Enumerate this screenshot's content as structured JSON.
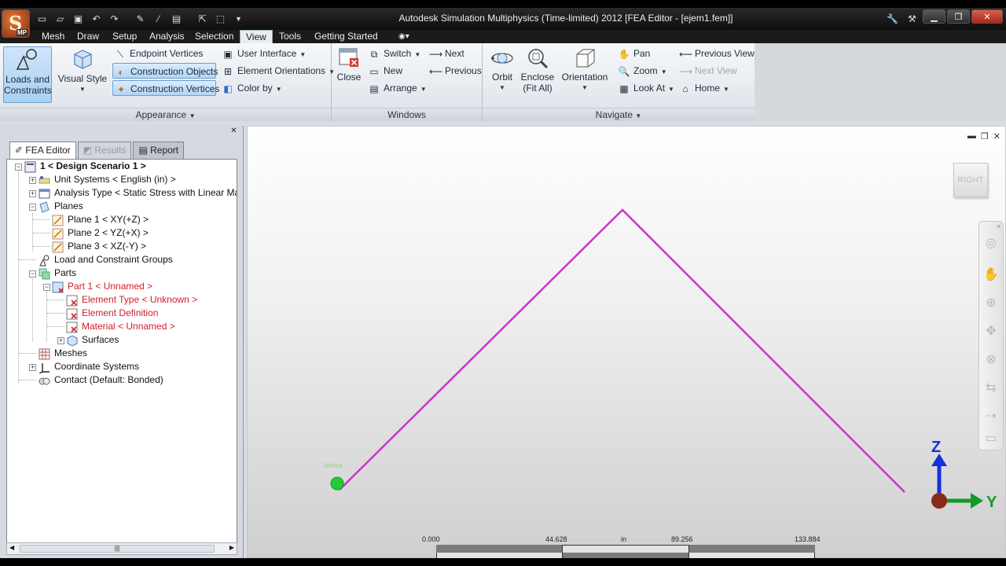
{
  "window": {
    "title": "Autodesk Simulation Multiphysics (Time-limited) 2012     [FEA Editor - [ejem1.fem]]"
  },
  "app_button": {
    "letter": "S",
    "badge": "MP"
  },
  "menu": {
    "tabs": [
      "Mesh",
      "Draw",
      "Setup",
      "Analysis",
      "Selection",
      "View",
      "Tools",
      "Getting Started"
    ],
    "active": "View"
  },
  "ribbon": {
    "appearance": {
      "label": "Appearance",
      "loads_and_constraints": "Loads and Constraints",
      "visual_style": "Visual Style",
      "endpoint_vertices": "Endpoint Vertices",
      "construction_objects": "Construction Objects",
      "construction_vertices": "Construction Vertices",
      "user_interface": "User Interface",
      "element_orientations": "Element Orientations",
      "color_by": "Color by"
    },
    "windows": {
      "label": "Windows",
      "close": "Close",
      "switch": "Switch",
      "new": "New",
      "arrange": "Arrange",
      "next": "Next",
      "previous": "Previous"
    },
    "navigate": {
      "label": "Navigate",
      "orbit": "Orbit",
      "enclose": "Enclose (Fit All)",
      "orientation": "Orientation",
      "pan": "Pan",
      "zoom": "Zoom",
      "look_at": "Look At",
      "previous_view": "Previous View",
      "next_view": "Next View",
      "home": "Home"
    }
  },
  "browser": {
    "tabs": {
      "fea_editor": "FEA Editor",
      "results": "Results",
      "report": "Report"
    },
    "tree": [
      "1 < Design Scenario 1 >",
      "Unit Systems < English (in) >",
      "Analysis Type < Static Stress with Linear Materi",
      "Planes",
      "Plane 1 < XY(+Z) >",
      "Plane 2 < YZ(+X) >",
      "Plane 3 < XZ(-Y) >",
      "Load and Constraint Groups",
      "Parts",
      "Part 1 < Unnamed >",
      "Element Type < Unknown >",
      "Element Definition",
      "Material < Unnamed >",
      "Surfaces",
      "Meshes",
      "Coordinate Systems",
      "Contact (Default: Bonded)"
    ]
  },
  "viewport": {
    "viewcube_label": "RIGHT",
    "vertex_label": "Vertex",
    "triad": {
      "z": "Z",
      "y": "Y"
    },
    "scale": {
      "ticks": [
        "0.000",
        "44.628",
        "89.256",
        "133.884"
      ],
      "unit": "in"
    }
  },
  "colors": {
    "line": "#cc33cc",
    "vertex": "#22cc33",
    "accent": "#2a6bd8"
  }
}
